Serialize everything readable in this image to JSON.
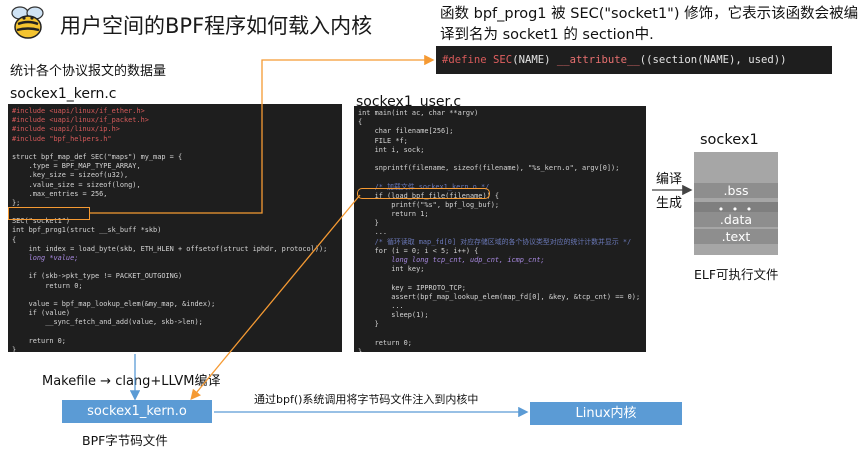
{
  "title": "用户空间的BPF程序如何载入内核",
  "note_top": "函数 bpf_prog1 被 SEC(\"socket1\") 修饰，它表示该函数会被编译到名为 socket1 的 section中.",
  "attr_code": {
    "define": "#define",
    "sec": "SEC",
    "args": "(NAME) ",
    "attribute": "__attribute__",
    "rest": "((section(NAME), used))"
  },
  "stats_label": "统计各个协议报文的数据量",
  "kern_file_label": "sockex1_kern.c",
  "user_file_label": "sockex1_user.c",
  "kern_code": [
    {
      "t": "#include <uapi/linux/if_ether.h>",
      "c": "inc"
    },
    {
      "t": "#include <uapi/linux/if_packet.h>",
      "c": "inc"
    },
    {
      "t": "#include <uapi/linux/ip.h>",
      "c": "inc"
    },
    {
      "t": "#include \"bpf_helpers.h\"",
      "c": "inc"
    },
    {
      "t": "",
      "c": ""
    },
    {
      "t": "struct bpf_map_def SEC(\"maps\") my_map = {",
      "c": ""
    },
    {
      "t": "    .type = BPF_MAP_TYPE_ARRAY,",
      "c": ""
    },
    {
      "t": "    .key_size = sizeof(u32),",
      "c": ""
    },
    {
      "t": "    .value_size = sizeof(long),",
      "c": ""
    },
    {
      "t": "    .max_entries = 256,",
      "c": ""
    },
    {
      "t": "};",
      "c": ""
    },
    {
      "t": "",
      "c": ""
    },
    {
      "t": "SEC(\"socket1\")",
      "c": ""
    },
    {
      "t": "int bpf_prog1(struct __sk_buff *skb)",
      "c": ""
    },
    {
      "t": "{",
      "c": ""
    },
    {
      "t": "    int index = load_byte(skb, ETH_HLEN + offsetof(struct iphdr, protocol));",
      "c": ""
    },
    {
      "t": "    long *value;",
      "c": "ital"
    },
    {
      "t": "",
      "c": ""
    },
    {
      "t": "    if (skb->pkt_type != PACKET_OUTGOING)",
      "c": ""
    },
    {
      "t": "        return 0;",
      "c": ""
    },
    {
      "t": "",
      "c": ""
    },
    {
      "t": "    value = bpf_map_lookup_elem(&my_map, &index);",
      "c": ""
    },
    {
      "t": "    if (value)",
      "c": ""
    },
    {
      "t": "        __sync_fetch_and_add(value, skb->len);",
      "c": ""
    },
    {
      "t": "",
      "c": ""
    },
    {
      "t": "    return 0;",
      "c": ""
    },
    {
      "t": "}",
      "c": ""
    },
    {
      "t": "char _license[] SEC(\"license\") = \"GPL\";",
      "c": ""
    }
  ],
  "user_code": [
    {
      "t": "int main(int ac, char **argv)",
      "c": ""
    },
    {
      "t": "{",
      "c": ""
    },
    {
      "t": "    char filename[256];",
      "c": ""
    },
    {
      "t": "    FILE *f;",
      "c": ""
    },
    {
      "t": "    int i, sock;",
      "c": ""
    },
    {
      "t": "",
      "c": ""
    },
    {
      "t": "    snprintf(filename, sizeof(filename), \"%s_kern.o\", argv[0]);",
      "c": ""
    },
    {
      "t": "",
      "c": ""
    },
    {
      "t": "    /* 加载文件 sockex1_kern.o */",
      "c": "cmt"
    },
    {
      "t": "    if (load_bpf_file(filename)) {",
      "c": ""
    },
    {
      "t": "        printf(\"%s\", bpf_log_buf);",
      "c": ""
    },
    {
      "t": "        return 1;",
      "c": ""
    },
    {
      "t": "    }",
      "c": ""
    },
    {
      "t": "    ...",
      "c": ""
    },
    {
      "t": "    /* 循环读取 map_fd[0] 对应存储区域的各个协议类型对应的统计计数并显示 */",
      "c": "cmt"
    },
    {
      "t": "    for (i = 0; i < 5; i++) {",
      "c": ""
    },
    {
      "t": "        long long tcp_cnt, udp_cnt, icmp_cnt;",
      "c": "ital"
    },
    {
      "t": "        int key;",
      "c": ""
    },
    {
      "t": "",
      "c": ""
    },
    {
      "t": "        key = IPPROTO_TCP;",
      "c": ""
    },
    {
      "t": "        assert(bpf_map_lookup_elem(map_fd[0], &key, &tcp_cnt) == 0);",
      "c": ""
    },
    {
      "t": "        ...",
      "c": ""
    },
    {
      "t": "        sleep(1);",
      "c": ""
    },
    {
      "t": "    }",
      "c": ""
    },
    {
      "t": "",
      "c": ""
    },
    {
      "t": "    return 0;",
      "c": ""
    },
    {
      "t": "}",
      "c": ""
    }
  ],
  "elf": {
    "title": "sockex1",
    "sections": [
      ".bss",
      "• • •",
      ".data",
      ".text"
    ],
    "caption": "ELF可执行文件",
    "compile_label": "编译",
    "generate_label": "生成"
  },
  "flow": {
    "makefile_label": "Makefile → clang+LLVM编译",
    "kern_o_label": "sockex1_kern.o",
    "bytecode_caption": "BPF字节码文件",
    "inject_caption": "通过bpf()系统调用将字节码文件注入到内核中",
    "linux_label": "Linux内核"
  },
  "colors": {
    "arrow_orange": "#f59a33",
    "box_blue": "#5b9bd5",
    "code_bg": "#1e1e1e",
    "elf_gray": "#8e8e8e"
  }
}
